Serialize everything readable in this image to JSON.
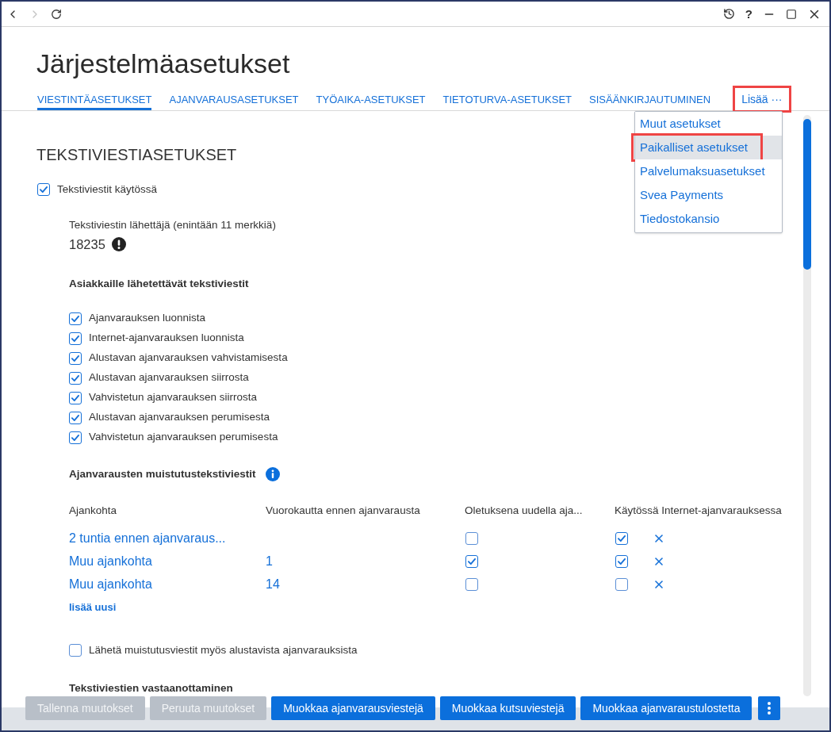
{
  "navigation": [
    {
      "kind": "back",
      "disabled": false
    },
    {
      "kind": "forward",
      "disabled": true
    },
    {
      "kind": "refresh",
      "disabled": false
    }
  ],
  "window_controls": [
    {
      "kind": "history"
    },
    {
      "kind": "help",
      "label": "?"
    },
    {
      "kind": "minimize"
    },
    {
      "kind": "maximize"
    },
    {
      "kind": "close"
    }
  ],
  "page_title": "Järjestelmäasetukset",
  "tabs": [
    {
      "kind": "tab",
      "label": "VIESTINTÄASETUKSET",
      "selected": true,
      "highlighted": false
    },
    {
      "kind": "tab",
      "label": "AJANVARAUSASETUKSET",
      "selected": false,
      "highlighted": false
    },
    {
      "kind": "tab",
      "label": "TYÖAIKA-ASETUKSET",
      "selected": false,
      "highlighted": false
    },
    {
      "kind": "tab",
      "label": "TIETOTURVA-ASETUKSET",
      "selected": false,
      "highlighted": false
    },
    {
      "kind": "tab",
      "label": "SISÄÄNKIRJAUTUMINEN",
      "selected": false,
      "highlighted": false
    },
    {
      "kind": "more",
      "label": "Lisää ···",
      "selected": false,
      "highlighted": true
    }
  ],
  "more_menu": {
    "items": [
      {
        "label": "Muut asetukset",
        "selected": false,
        "highlighted": false
      },
      {
        "label": "Paikalliset asetukset",
        "selected": true,
        "highlighted": true
      },
      {
        "label": "Palvelumaksuasetukset",
        "selected": false,
        "highlighted": false
      },
      {
        "label": "Svea Payments",
        "selected": false,
        "highlighted": false
      },
      {
        "label": "Tiedostokansio",
        "selected": false,
        "highlighted": false
      }
    ]
  },
  "sms_settings": {
    "title": "TEKSTIVIESTIASETUKSET",
    "enabled": {
      "label": "Tekstiviestit käytössä",
      "checked": true
    },
    "sender": {
      "label": "Tekstiviestin lähettäjä (enintään 11 merkkiä)",
      "value": "18235"
    },
    "customer_messages": {
      "heading": "Asiakkaille lähetettävät tekstiviestit",
      "options": [
        {
          "label": "Ajanvarauksen luonnista",
          "checked": true
        },
        {
          "label": "Internet-ajanvarauksen luonnista",
          "checked": true
        },
        {
          "label": "Alustavan ajanvarauksen vahvistamisesta",
          "checked": true
        },
        {
          "label": "Alustavan ajanvarauksen siirrosta",
          "checked": true
        },
        {
          "label": "Vahvistetun ajanvarauksen siirrosta",
          "checked": true
        },
        {
          "label": "Alustavan ajanvarauksen perumisesta",
          "checked": true
        },
        {
          "label": "Vahvistetun ajanvarauksen perumisesta",
          "checked": true
        }
      ]
    },
    "reminders": {
      "heading": "Ajanvarausten muistutustekstiviestit",
      "columns": [
        "Ajankohta",
        "Vuorokautta ennen ajanvarausta",
        "Oletuksena uudella aja...",
        "Käytössä Internet-ajanvarauksessa"
      ],
      "rows": [
        {
          "time": "2 tuntia ennen ajanvaraus...",
          "default_on_new": false,
          "internet": true
        },
        {
          "time": "Muu ajankohta",
          "days": "1",
          "default_on_new": true,
          "internet": true
        },
        {
          "time": "Muu ajankohta",
          "days": "14",
          "default_on_new": false,
          "internet": false
        }
      ],
      "add_link": "lisää uusi"
    },
    "tentative_reminders": {
      "label": "Lähetä muistutusviestit myös alustavista ajanvarauksista",
      "checked": false
    },
    "receiving": {
      "heading": "Tekstiviestien vastaanottaminen"
    }
  },
  "footer": {
    "buttons": [
      {
        "kind": "text",
        "label": "Tallenna muutokset",
        "disabled": true
      },
      {
        "kind": "text",
        "label": "Peruuta muutokset",
        "disabled": true
      },
      {
        "kind": "text",
        "label": "Muokkaa ajanvarausviestejä",
        "disabled": false
      },
      {
        "kind": "text",
        "label": "Muokkaa kutsuviestejä",
        "disabled": false
      },
      {
        "kind": "text",
        "label": "Muokkaa ajanvaraustulostetta",
        "disabled": false
      },
      {
        "kind": "more",
        "disabled": false
      }
    ]
  }
}
